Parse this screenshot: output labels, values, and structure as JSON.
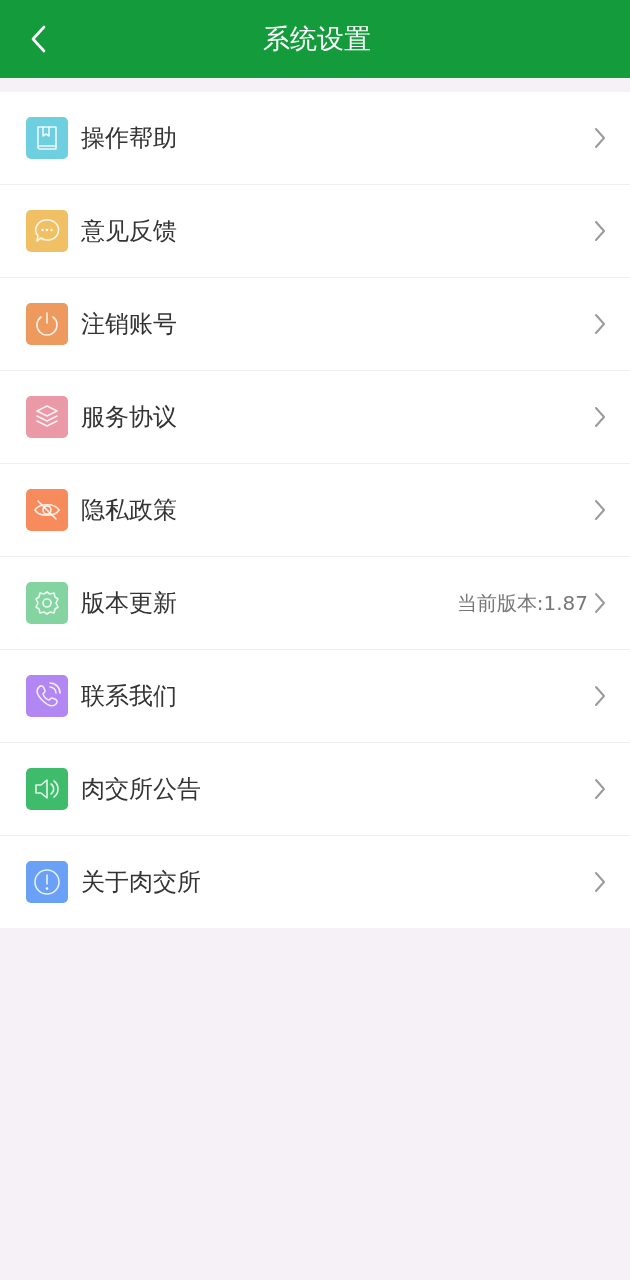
{
  "header": {
    "title": "系统设置"
  },
  "items": [
    {
      "label": "操作帮助",
      "kind": "book",
      "color": "#6dcfe0"
    },
    {
      "label": "意见反馈",
      "kind": "chat",
      "color": "#f1c065"
    },
    {
      "label": "注销账号",
      "kind": "power",
      "color": "#ee9a5e"
    },
    {
      "label": "服务协议",
      "kind": "layers",
      "color": "#e99aa6"
    },
    {
      "label": "隐私政策",
      "kind": "eye-off",
      "color": "#f88b5c"
    },
    {
      "label": "版本更新",
      "kind": "gear",
      "color": "#84d4a2",
      "value": "当前版本:1.87"
    },
    {
      "label": "联系我们",
      "kind": "phone",
      "color": "#b286f3"
    },
    {
      "label": "肉交所公告",
      "kind": "speaker",
      "color": "#3fbb6c"
    },
    {
      "label": "关于肉交所",
      "kind": "info",
      "color": "#6aa0f5"
    }
  ]
}
